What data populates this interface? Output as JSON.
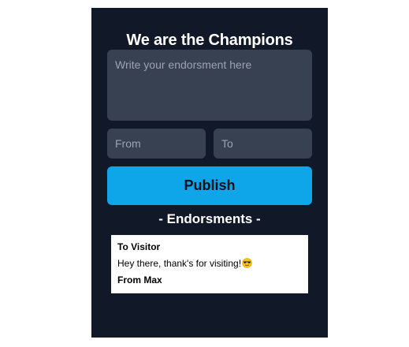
{
  "app": {
    "title": "We are the Champions",
    "endorsement_placeholder": "Write your endorsment here",
    "from_placeholder": "From",
    "to_placeholder": "To",
    "publish_label": "Publish",
    "section_heading": "- Endorsments -"
  },
  "endorsements": [
    {
      "to": "To Visitor",
      "message": "Hey there, thank's for visiting!",
      "emoji": "sunglasses-emoji-icon",
      "from": "From Max"
    }
  ],
  "colors": {
    "background": "#111827",
    "input": "#374151",
    "accent": "#0ea5e9"
  }
}
